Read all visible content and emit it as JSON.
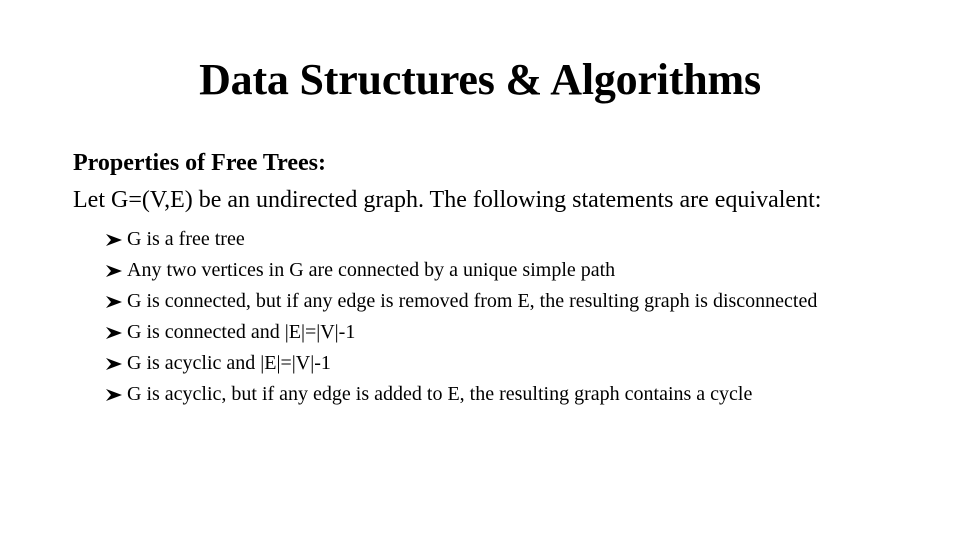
{
  "slide": {
    "title": "Data Structures & Algorithms",
    "heading": "Properties of Free Trees:",
    "intro": "Let G=(V,E) be an undirected graph. The following statements are equivalent:",
    "bullet_icon": "arrowhead-bullet-icon",
    "bullets": [
      "G is a free tree",
      "Any two vertices in G are connected by a unique simple path",
      "G is connected, but if any edge is removed from E, the resulting graph is disconnected",
      "G is connected and |E|=|V|-1",
      "G is acyclic and |E|=|V|-1",
      "G is acyclic, but if any edge is added to E, the resulting graph contains a cycle"
    ]
  }
}
